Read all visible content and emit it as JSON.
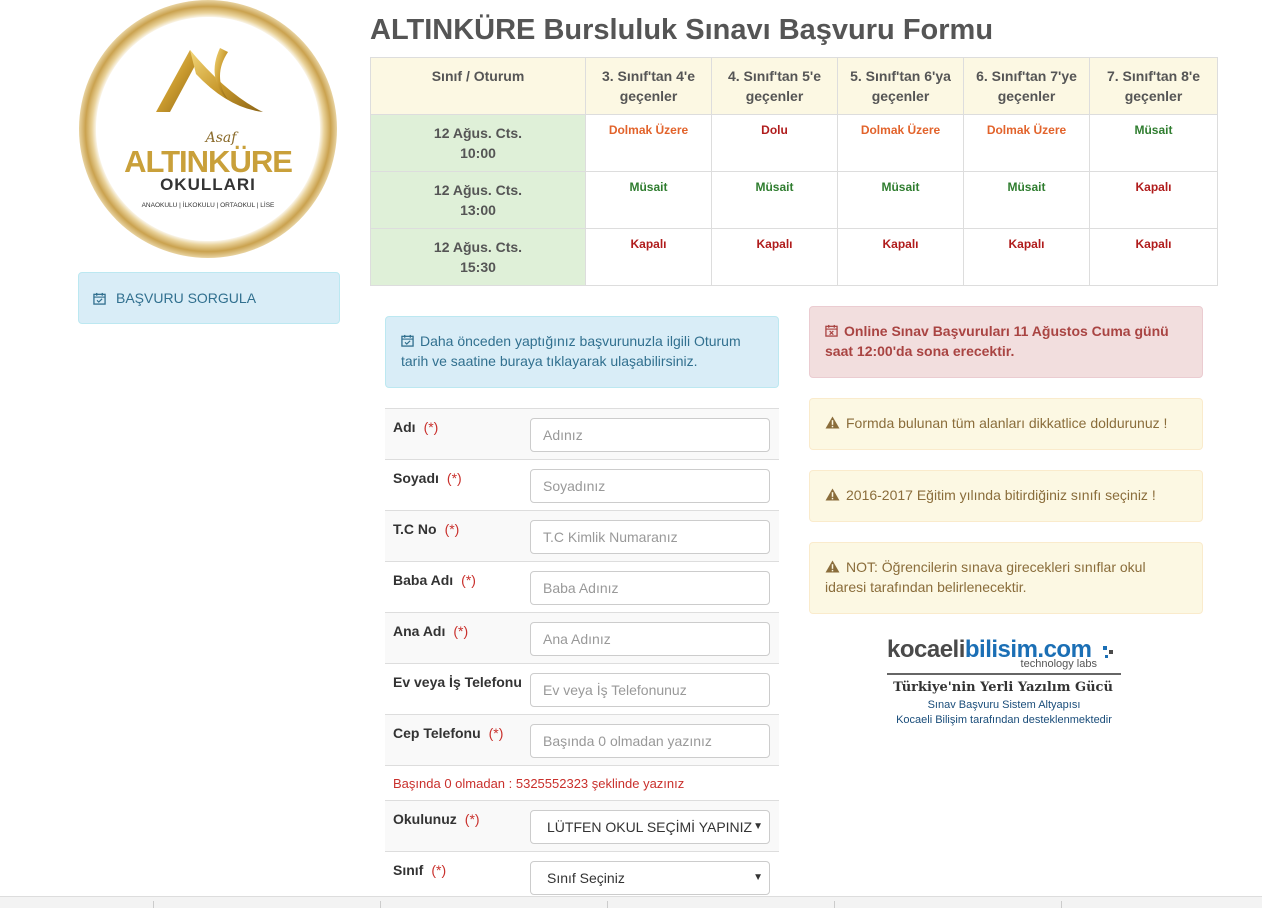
{
  "logo": {
    "script_text": "Asaf",
    "brand_text": "ALTINKÜRE",
    "sub_text": "OKULLARI",
    "levels_text": "ANAOKULU | İLKOKULU | ORTAOKUL | LİSE"
  },
  "sidebar": {
    "query_button_label": "BAŞVURU SORGULA"
  },
  "title": "ALTINKÜRE Bursluluk Sınavı Başvuru Formu",
  "schedule": {
    "header_first": "Sınıf / Oturum",
    "columns": [
      {
        "line1": "3. Sınıf'tan 4'e",
        "line2": "geçenler"
      },
      {
        "line1": "4. Sınıf'tan 5'e",
        "line2": "geçenler"
      },
      {
        "line1": "5. Sınıf'tan 6'ya",
        "line2": "geçenler"
      },
      {
        "line1": "6. Sınıf'tan 7'ye",
        "line2": "geçenler"
      },
      {
        "line1": "7. Sınıf'tan 8'e",
        "line2": "geçenler"
      }
    ],
    "rows": [
      {
        "date": "12 Ağus. Cts.",
        "time": "10:00",
        "cells": [
          "Dolmak Üzere",
          "Dolu",
          "Dolmak Üzere",
          "Dolmak Üzere",
          "Müsait"
        ]
      },
      {
        "date": "12 Ağus. Cts.",
        "time": "13:00",
        "cells": [
          "Müsait",
          "Müsait",
          "Müsait",
          "Müsait",
          "Kapalı"
        ]
      },
      {
        "date": "12 Ağus. Cts.",
        "time": "15:30",
        "cells": [
          "Kapalı",
          "Kapalı",
          "Kapalı",
          "Kapalı",
          "Kapalı"
        ]
      }
    ],
    "status_colors": {
      "Dolmak Üzere": "#e2632b",
      "Dolu": "#b01c1c",
      "Müsait": "#2f7d2f",
      "Kapalı": "#b01c1c"
    }
  },
  "info": {
    "text": "Daha önceden yaptığınız başvurunuzla ilgili Oturum tarih ve saatine buraya tıklayarak ulaşabilirsiniz."
  },
  "form": {
    "required_mark": "(*)",
    "fields": {
      "ad": {
        "label": "Adı",
        "placeholder": "Adınız"
      },
      "soyad": {
        "label": "Soyadı",
        "placeholder": "Soyadınız"
      },
      "tc": {
        "label": "T.C No",
        "placeholder": "T.C Kimlik Numaranız"
      },
      "baba": {
        "label": "Baba Adı",
        "placeholder": "Baba Adınız"
      },
      "ana": {
        "label": "Ana Adı",
        "placeholder": "Ana Adınız"
      },
      "evtel": {
        "label": "Ev veya İş Telefonu",
        "placeholder": "Ev veya İş Telefonunuz"
      },
      "cep": {
        "label": "Cep Telefonu",
        "placeholder": "Başında 0 olmadan yazınız"
      }
    },
    "phone_hint": "Başında 0 olmadan : 5325552323 şeklinde yazınız",
    "okul": {
      "label": "Okulunuz",
      "selected": "LÜTFEN OKUL SEÇİMİ YAPINIZ"
    },
    "sinif": {
      "label": "Sınıf",
      "selected": "Sınıf Seçiniz"
    }
  },
  "alerts": {
    "deadline": "Online Sınav Başvuruları 11 Ağustos Cuma günü saat 12:00'da sona erecektir.",
    "warn1": "Formda bulunan tüm alanları dikkatlice doldurunuz !",
    "warn2": "2016-2017 Eğitim yılında bitirdiğiniz sınıfı seçiniz !",
    "warn3": "NOT: Öğrencilerin sınava girecekleri sınıflar okul idaresi tarafından belirlenecektir."
  },
  "partner": {
    "name_part1": "kocaeli",
    "name_part2": "bilisim.com",
    "tagline": "technology labs",
    "slogan": "Türkiye'nin Yerli Yazılım Gücü",
    "sub1": "Sınav Başvuru Sistem Altyapısı",
    "sub2": "Kocaeli Bilişim tarafından desteklenmektedir"
  }
}
